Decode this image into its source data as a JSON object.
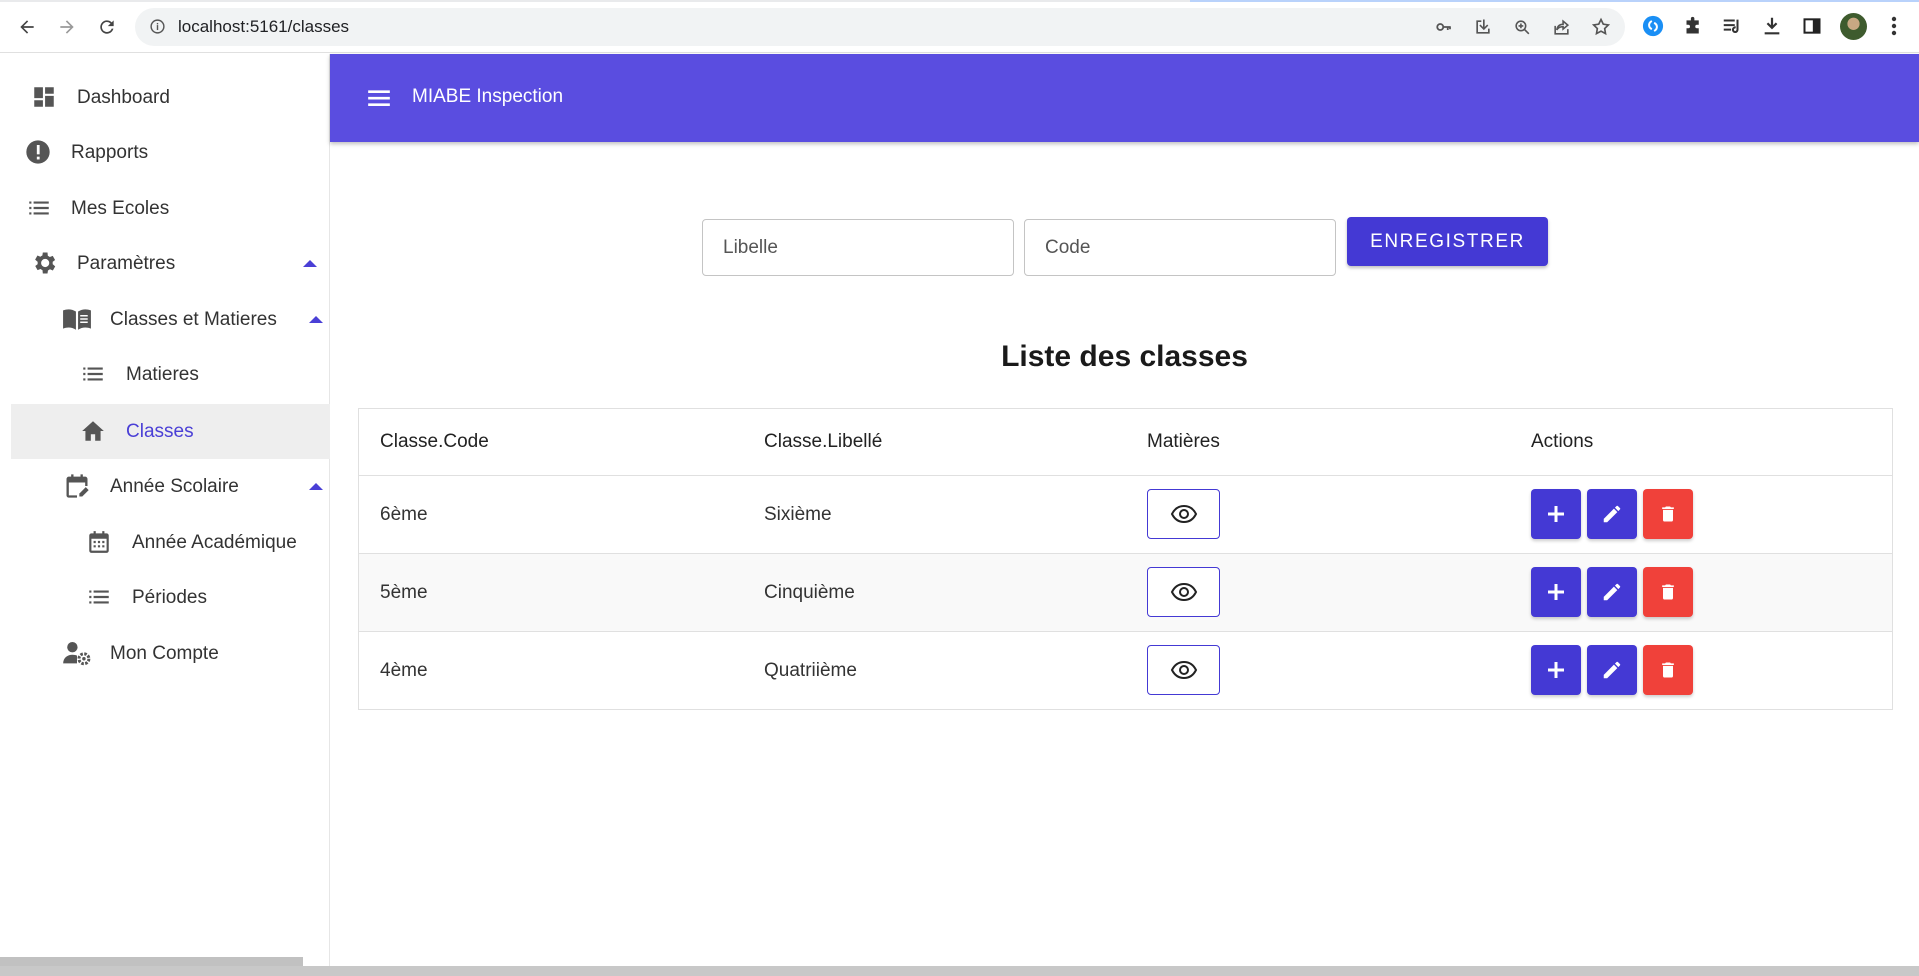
{
  "browser": {
    "url": "localhost:5161/classes"
  },
  "sidebar": {
    "items": [
      {
        "label": "Dashboard",
        "icon": "dashboard-icon"
      },
      {
        "label": "Rapports",
        "icon": "alert-circle-icon"
      },
      {
        "label": "Mes Ecoles",
        "icon": "list-icon"
      },
      {
        "label": "Paramètres",
        "icon": "gear-icon"
      },
      {
        "label": "Classes et Matieres",
        "icon": "book-icon"
      },
      {
        "label": "Matieres",
        "icon": "list-icon"
      },
      {
        "label": "Classes",
        "icon": "home-icon",
        "active": true
      },
      {
        "label": "Année Scolaire",
        "icon": "calendar-edit-icon"
      },
      {
        "label": "Année Académique",
        "icon": "calendar-icon"
      },
      {
        "label": "Périodes",
        "icon": "list-icon"
      },
      {
        "label": "Mon Compte",
        "icon": "user-settings-icon"
      }
    ]
  },
  "appbar": {
    "title": "MIABE Inspection"
  },
  "form": {
    "libelle_placeholder": "Libelle",
    "code_placeholder": "Code",
    "save_label": "ENREGISTRER"
  },
  "list": {
    "title": "Liste des classes",
    "headers": [
      "Classe.Code",
      "Classe.Libellé",
      "Matières",
      "Actions"
    ],
    "rows": [
      {
        "code": "6ème",
        "libelle": "Sixième"
      },
      {
        "code": "5ème",
        "libelle": "Cinquième"
      },
      {
        "code": "4ème",
        "libelle": "Quatriième"
      }
    ]
  },
  "colors": {
    "primary": "#5a4de0",
    "button": "#4439d4",
    "danger": "#f0413a"
  }
}
